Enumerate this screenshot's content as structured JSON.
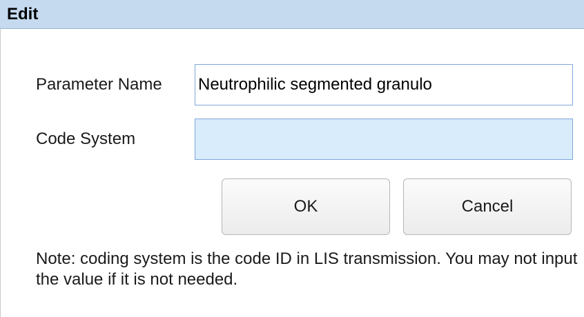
{
  "dialog": {
    "title": "Edit"
  },
  "form": {
    "parameter_name_label": "Parameter Name",
    "parameter_name_value": "Neutrophilic segmented granulo",
    "code_system_label": "Code System",
    "code_system_value": ""
  },
  "buttons": {
    "ok_label": "OK",
    "cancel_label": "Cancel"
  },
  "note": "Note: coding system is the code ID in LIS transmission. You may not input the value if it is not needed.",
  "colors": {
    "titlebar": "#c5d9ef",
    "code_field_bg": "#d9ecfb",
    "field_border": "#7ea6d9"
  }
}
